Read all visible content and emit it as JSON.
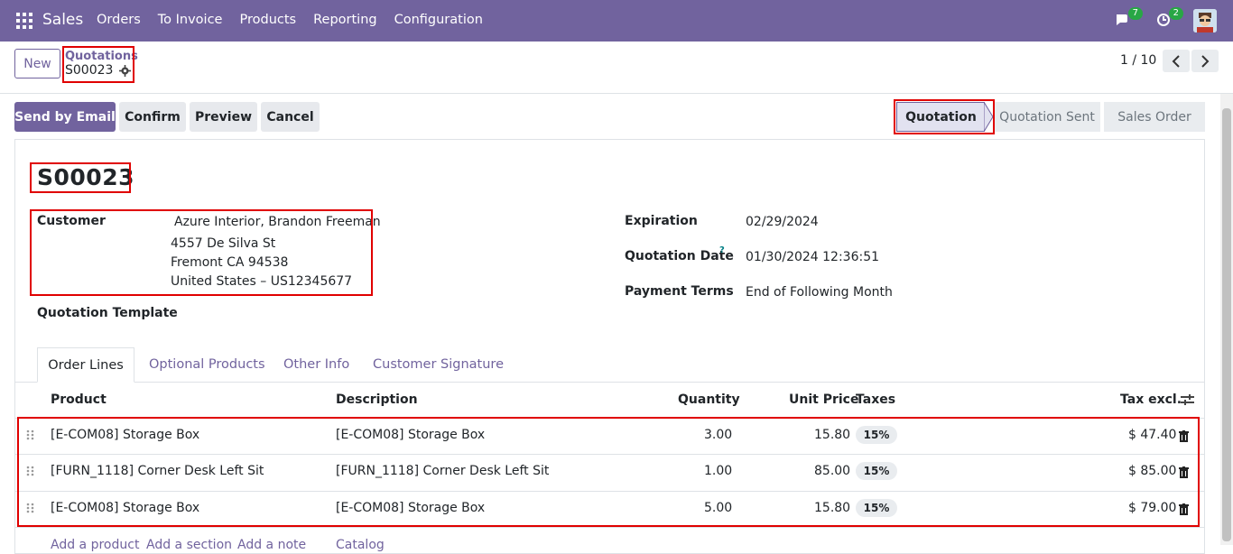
{
  "navbar": {
    "brand": "Sales",
    "menu": [
      "Orders",
      "To Invoice",
      "Products",
      "Reporting",
      "Configuration"
    ],
    "messages_count": "7",
    "activities_count": "2"
  },
  "control": {
    "new_label": "New",
    "breadcrumb_parent": "Quotations",
    "breadcrumb_current": "S00023",
    "pager": "1 / 10"
  },
  "actions": {
    "send_email": "Send by Email",
    "confirm": "Confirm",
    "preview": "Preview",
    "cancel": "Cancel"
  },
  "status": {
    "stages": [
      "Quotation",
      "Quotation Sent",
      "Sales Order"
    ],
    "active": "Quotation"
  },
  "form": {
    "title": "S00023",
    "customer_label": "Customer",
    "customer_name": "Azure Interior, Brandon Freeman",
    "address_line1": "4557 De Silva St",
    "address_line2": "Fremont CA 94538",
    "address_line3": "United States – US12345677",
    "template_label": "Quotation Template",
    "expiration_label": "Expiration",
    "expiration_value": "02/29/2024",
    "quotation_date_label": "Quotation Date",
    "quotation_date_help": "?",
    "quotation_date_value": "01/30/2024 12:36:51",
    "payment_terms_label": "Payment Terms",
    "payment_terms_value": "End of Following Month"
  },
  "tabs": [
    "Order Lines",
    "Optional Products",
    "Other Info",
    "Customer Signature"
  ],
  "table": {
    "headers": {
      "product": "Product",
      "description": "Description",
      "quantity": "Quantity",
      "unit_price": "Unit Price",
      "taxes": "Taxes",
      "tax_excl": "Tax excl."
    },
    "rows": [
      {
        "product": "[E-COM08] Storage Box",
        "description": "[E-COM08] Storage Box",
        "quantity": "3.00",
        "unit_price": "15.80",
        "tax": "15%",
        "subtotal": "$ 47.40"
      },
      {
        "product": "[FURN_1118] Corner Desk Left Sit",
        "description": "[FURN_1118] Corner Desk Left Sit",
        "quantity": "1.00",
        "unit_price": "85.00",
        "tax": "15%",
        "subtotal": "$ 85.00"
      },
      {
        "product": "[E-COM08] Storage Box",
        "description": "[E-COM08] Storage Box",
        "quantity": "5.00",
        "unit_price": "15.80",
        "tax": "15%",
        "subtotal": "$ 79.00"
      }
    ],
    "footer_links": [
      "Add a product",
      "Add a section",
      "Add a note",
      "Catalog"
    ]
  }
}
